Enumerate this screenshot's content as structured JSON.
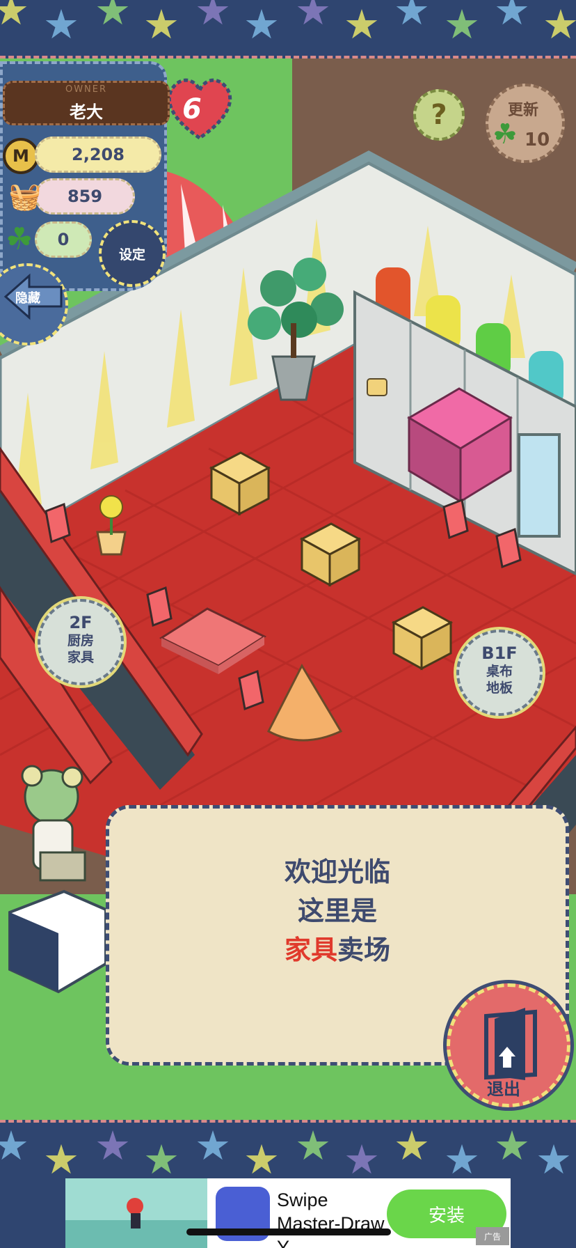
{
  "owner": {
    "label": "OWNER",
    "name": "老大"
  },
  "hearts": {
    "count": "6"
  },
  "stats": {
    "coins": "2,208",
    "food": "859",
    "clovers": "0",
    "coin_symbol": "M"
  },
  "buttons": {
    "settings": "设定",
    "hide": "隐藏",
    "help": "?",
    "refresh": "更新",
    "refresh_cost": "10",
    "exit": "退出"
  },
  "floors": [
    {
      "floor": "2F",
      "line1": "厨房",
      "line2": "家具"
    },
    {
      "floor": "B1F",
      "line1": "桌布",
      "line2": "地板"
    }
  ],
  "dialog": {
    "line1": "欢迎光临",
    "line2": "这里是",
    "highlight": "家具",
    "line3_rest": "卖场"
  },
  "ad": {
    "title": "Swipe Master-Draw Y",
    "install": "安装",
    "tag": "广告"
  },
  "colors": {
    "carpet": "#c8322d",
    "wall": "#e9ebe6",
    "dialog_bg": "#efe4c6",
    "text": "#3e4a6e",
    "highlight": "#e03a2c"
  }
}
